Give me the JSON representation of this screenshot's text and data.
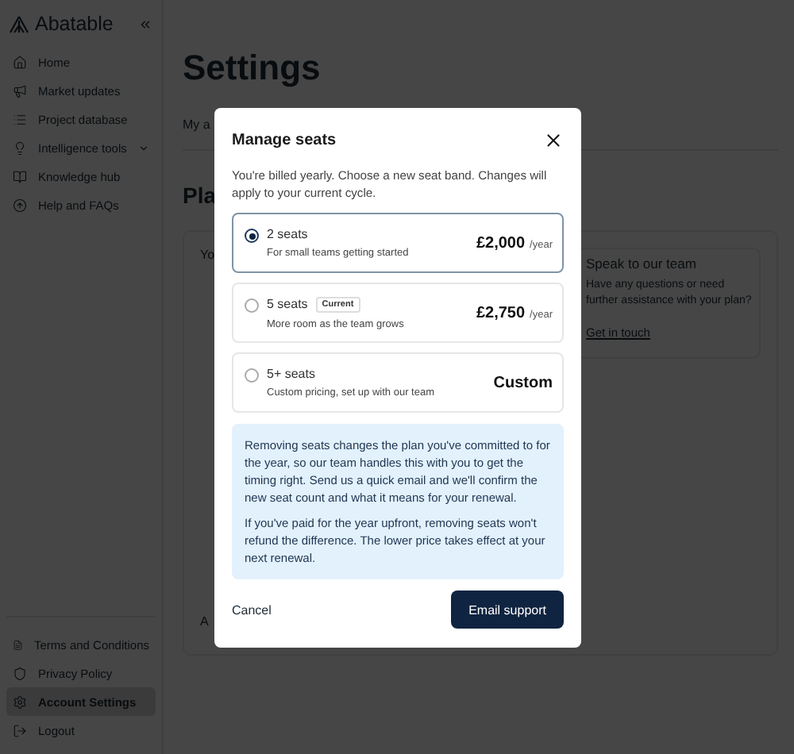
{
  "sidebar": {
    "logo": "Abatable",
    "nav": [
      {
        "label": "Home",
        "kind": "link",
        "selected": false
      },
      {
        "label": "Market updates",
        "kind": "link",
        "selected": false
      },
      {
        "label": "Project database",
        "kind": "link",
        "selected": false
      },
      {
        "label": "Intelligence tools",
        "kind": "group",
        "expanded": false,
        "selected": false
      },
      {
        "label": "Knowledge hub",
        "kind": "link",
        "selected": false
      },
      {
        "label": "Help and FAQs",
        "kind": "link",
        "selected": false
      }
    ],
    "footer": [
      {
        "label": "Terms and Conditions",
        "selected": false
      },
      {
        "label": "Privacy Policy",
        "selected": false
      },
      {
        "label": "Account Settings",
        "selected": true
      },
      {
        "label": "Logout",
        "selected": false
      }
    ]
  },
  "page": {
    "title": "Settings",
    "tab": "My a",
    "section": "Pla",
    "plan_text": "Yo",
    "plan_footer": "A",
    "contact": {
      "title": "Speak to our team",
      "text": "Have any questions or need further assistance with your plan?",
      "link": "Get in touch"
    }
  },
  "modal": {
    "title": "Manage seats",
    "description": "You're billed yearly. Choose a new seat band. Changes will apply to your current cycle.",
    "options": [
      {
        "title": "2 seats",
        "subtitle": "For small teams getting started",
        "price": "£2,000",
        "period": "/year",
        "selected": true
      },
      {
        "title": "5 seats",
        "badge": "Current",
        "subtitle": "More room as the team grows",
        "price": "£2,750",
        "period": "/year",
        "selected": false
      },
      {
        "title": "5+ seats",
        "subtitle": "Custom pricing, set up with our team",
        "price": "Custom",
        "selected": false
      }
    ],
    "notice": [
      "Removing seats changes the plan you've committed to for the year, so our team handles this with you to get the timing right. Send us a quick email and we'll confirm the new seat count and what it means for your renewal.",
      "If you've paid for the year upfront, removing seats won't refund the difference. The lower price takes effect at your next renewal."
    ],
    "cancel": "Cancel",
    "submit": "Email support"
  }
}
